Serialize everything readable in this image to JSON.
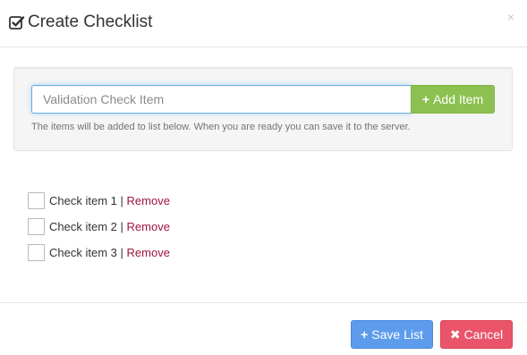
{
  "header": {
    "title": "Create Checklist",
    "title_icon": "check-square-icon",
    "close_glyph": "×"
  },
  "add_panel": {
    "input": {
      "value": "",
      "placeholder": "Validation Check Item"
    },
    "add_button": {
      "icon": "plus-icon",
      "icon_glyph": "+",
      "label": "Add Item"
    },
    "help_text": "The items will be added to list below. When you are ready you can save it to the server."
  },
  "checklist": {
    "separator": "|",
    "items": [
      {
        "label": "Check item 1",
        "checked": false,
        "remove_label": "Remove"
      },
      {
        "label": "Check item 2",
        "checked": false,
        "remove_label": "Remove"
      },
      {
        "label": "Check item 3",
        "checked": false,
        "remove_label": "Remove"
      }
    ]
  },
  "footer": {
    "save_button": {
      "icon": "plus-icon",
      "icon_glyph": "+",
      "label": "Save List"
    },
    "cancel_button": {
      "icon": "times-icon",
      "icon_glyph": "✖",
      "label": "Cancel"
    }
  },
  "colors": {
    "add_button": "#8cc152",
    "save_button": "#5d9cec",
    "cancel_button": "#e9546b",
    "remove_link": "#a0153e",
    "input_focus": "#66afe9"
  }
}
